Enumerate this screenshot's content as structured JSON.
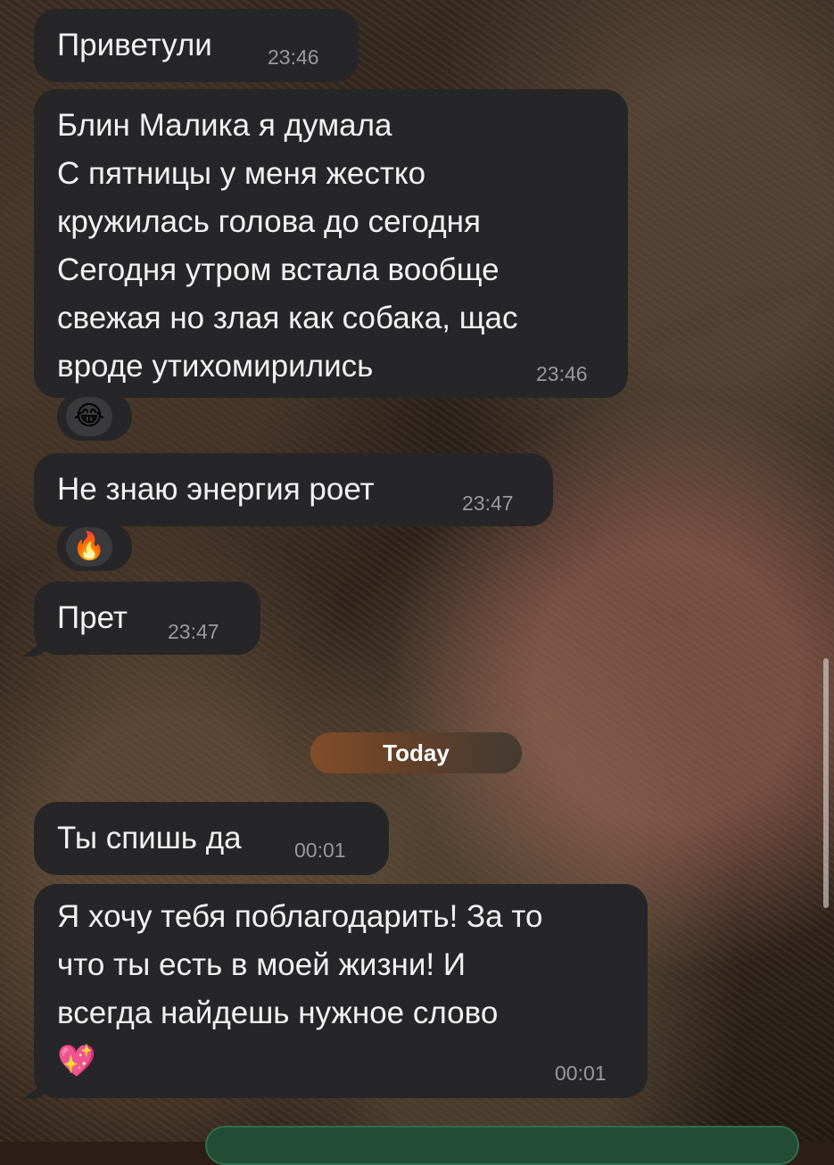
{
  "messages": [
    {
      "text": "Приветули",
      "time": "23:46"
    },
    {
      "text": "Блин Малика я думала\nС пятницы у меня жестко\nкружилась голова до сегодня\nСегодня утром встала вообще\nсвежая но злая как собака, щас\nвроде утихомирились",
      "time": "23:46",
      "reaction": "😂"
    },
    {
      "text": "Не знаю энергия роет",
      "time": "23:47",
      "reaction": "🔥"
    },
    {
      "text": "Прет",
      "time": "23:47"
    },
    {
      "text": "Ты спишь да",
      "time": "00:01"
    },
    {
      "text": "Я хочу тебя поблагодарить! За то\nчто ты есть в моей жизни! И\nвсегда найдешь нужное слово\n💖",
      "time": "00:01"
    }
  ],
  "date_separator": "Today",
  "icons": {
    "reaction_laugh": "face-with-tears-of-joy",
    "reaction_fire": "fire",
    "heart": "sparkling-heart"
  },
  "colors": {
    "bubble": "#262628",
    "time": "#9a9a9c",
    "compose": "#234c36"
  }
}
